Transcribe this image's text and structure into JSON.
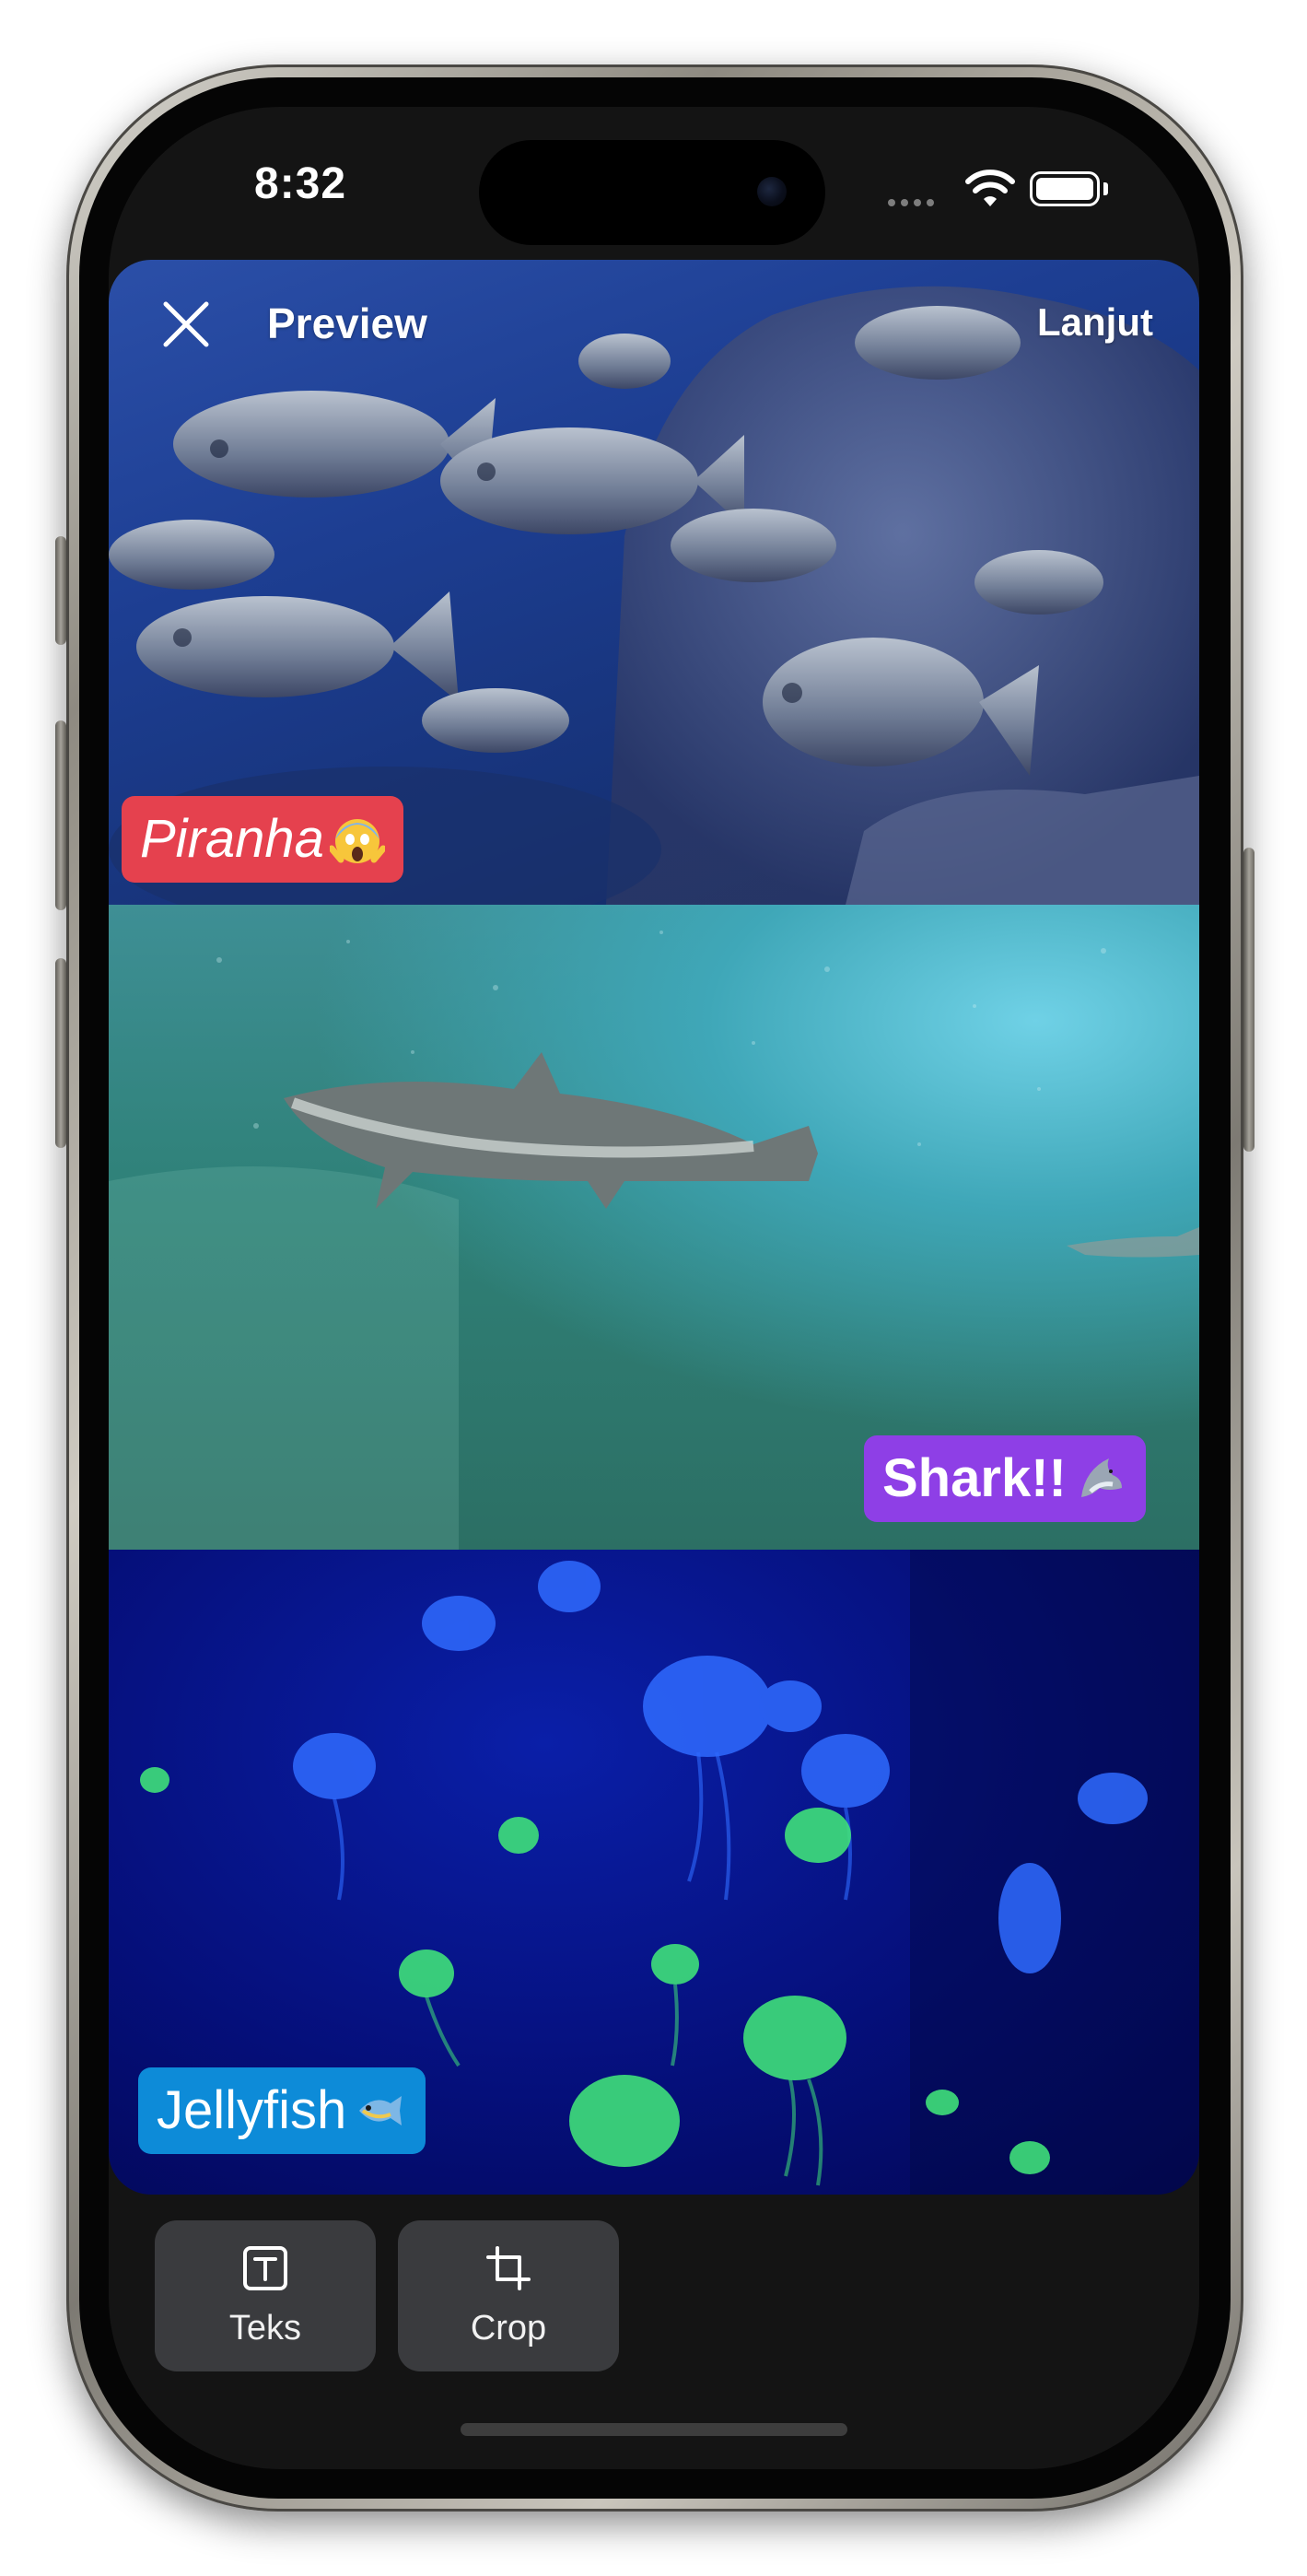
{
  "status_bar": {
    "time": "8:32"
  },
  "header": {
    "title": "Preview",
    "next_label": "Lanjut"
  },
  "captions": [
    {
      "text": "Piranha",
      "emoji": "scream-emoji",
      "color": "#e5414e"
    },
    {
      "text": "Shark!!",
      "emoji": "shark-emoji",
      "color": "#8e3fe6"
    },
    {
      "text": "Jellyfish",
      "emoji": "fish-emoji",
      "color": "#0d8bd8"
    }
  ],
  "tools": [
    {
      "label": "Teks",
      "icon": "text-box-icon"
    },
    {
      "label": "Crop",
      "icon": "crop-icon"
    }
  ],
  "colors": {
    "screen_background": "#141414",
    "tool_button": "#3a3b3e",
    "phone_frame": "#9a968d"
  }
}
